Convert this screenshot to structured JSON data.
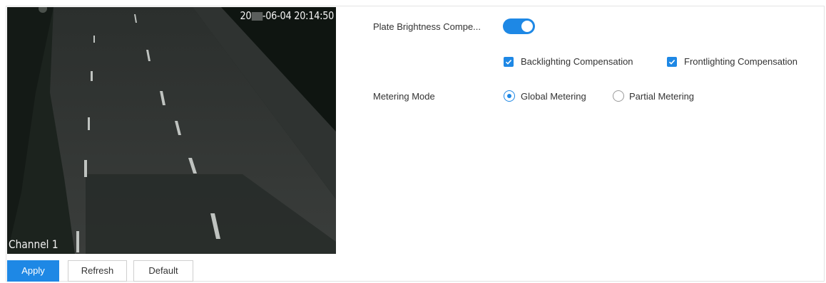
{
  "preview": {
    "timestamp_prefix": "20",
    "timestamp_suffix": "-06-04 20:14:50",
    "channel_label": "Channel 1"
  },
  "settings": {
    "plate_brightness": {
      "label": "Plate Brightness Compe...",
      "enabled": true
    },
    "backlighting": {
      "label": "Backlighting Compensation",
      "checked": true
    },
    "frontlighting": {
      "label": "Frontlighting Compensation",
      "checked": true
    },
    "metering": {
      "label": "Metering Mode",
      "options": [
        "Global Metering",
        "Partial Metering"
      ],
      "selected": "Global Metering"
    }
  },
  "actions": {
    "apply_label": "Apply",
    "refresh_label": "Refresh",
    "default_label": "Default"
  },
  "colors": {
    "accent": "#1e88e5"
  }
}
